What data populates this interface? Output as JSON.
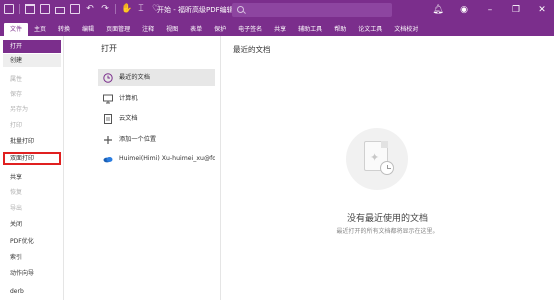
{
  "titlebar": {
    "title": "开始 - 福昕高级PDF编辑器",
    "colors": {
      "brand": "#7b2e8c",
      "highlight": "#e02020"
    },
    "quick_icons": [
      "app-icon",
      "folder-icon",
      "save-icon",
      "print-icon",
      "new-icon",
      "undo-icon",
      "redo-icon",
      "hand-icon",
      "select-icon",
      "heart-icon"
    ],
    "window_controls": [
      "bell-icon",
      "account-icon",
      "minimize-icon",
      "restore-icon",
      "close-icon"
    ]
  },
  "menu": {
    "items": [
      "文件",
      "主页",
      "转换",
      "编辑",
      "页面管理",
      "注释",
      "视图",
      "表单",
      "保护",
      "电子签名",
      "共享",
      "辅助工具",
      "帮助",
      "论文工具",
      "文档校对"
    ],
    "active_index": 0
  },
  "left_menu": {
    "items": [
      {
        "label": "打开",
        "state": "active"
      },
      {
        "label": "创建",
        "state": "sub"
      },
      {
        "label": "属性",
        "state": "disabled"
      },
      {
        "label": "保存",
        "state": "disabled"
      },
      {
        "label": "另存为",
        "state": "disabled"
      },
      {
        "label": "打印",
        "state": "disabled"
      },
      {
        "label": "批量打印",
        "state": "normal"
      },
      {
        "label": "双面打印",
        "state": "outlined"
      },
      {
        "label": "共享",
        "state": "normal"
      },
      {
        "label": "恢复",
        "state": "disabled"
      },
      {
        "label": "导出",
        "state": "disabled"
      },
      {
        "label": "关闭",
        "state": "normal"
      },
      {
        "label": "PDF优化",
        "state": "normal"
      },
      {
        "label": "索引",
        "state": "normal"
      },
      {
        "label": "动作向导",
        "state": "normal"
      },
      {
        "label": "derb",
        "state": "normal"
      }
    ]
  },
  "open_panel": {
    "title": "打开",
    "items": [
      {
        "label": "最近的文档",
        "icon": "clock-icon",
        "selected": true
      },
      {
        "label": "计算机",
        "icon": "computer-icon",
        "selected": false
      },
      {
        "label": "云文档",
        "icon": "cloud-doc-icon",
        "selected": false
      },
      {
        "label": "添加一个位置",
        "icon": "plus-icon",
        "selected": false
      },
      {
        "label": "Huimei(Himi) Xu-huimei_xu@fo...",
        "icon": "onedrive-icon",
        "selected": false
      }
    ]
  },
  "recent_panel": {
    "title": "最近的文档",
    "empty_title": "没有最近使用的文档",
    "empty_subtitle": "最近打开的所有文档都将显示在这里。"
  }
}
